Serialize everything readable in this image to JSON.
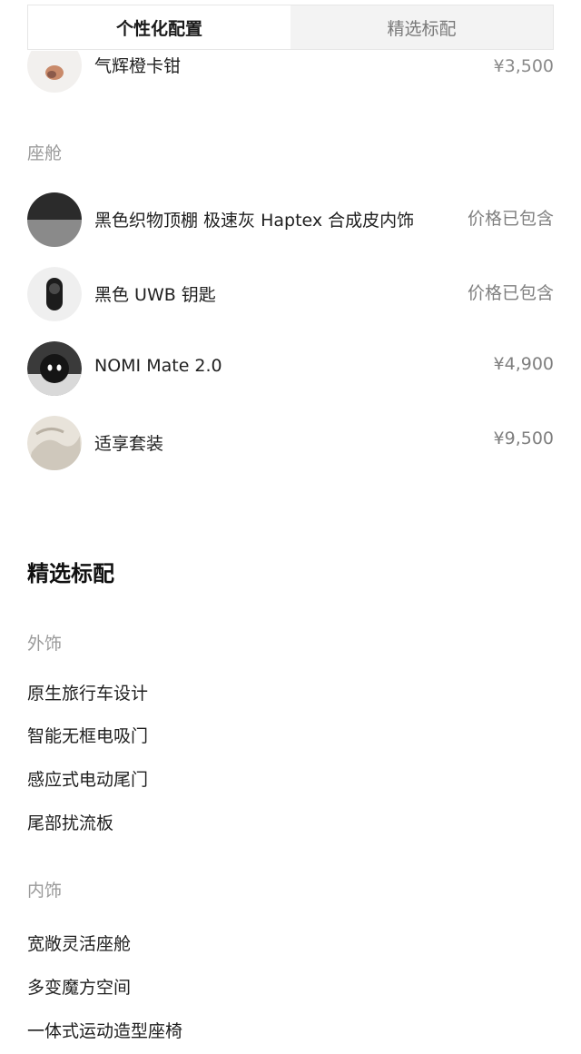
{
  "tabs": [
    {
      "label": "个性化配置",
      "active": true
    },
    {
      "label": "精选标配",
      "active": false
    }
  ],
  "partial_item": {
    "name": "气辉橙卡钳",
    "price": "¥3,500"
  },
  "cabin": {
    "label": "座舱",
    "items": [
      {
        "name": "黑色织物顶棚 极速灰 Haptex 合成皮内饰",
        "price": "价格已包含",
        "icon": "interior-swatch-icon"
      },
      {
        "name": "黑色 UWB 钥匙",
        "price": "价格已包含",
        "icon": "uwb-key-icon"
      },
      {
        "name": "NOMI Mate 2.0",
        "price": "¥4,900",
        "icon": "nomi-mate-icon"
      },
      {
        "name": "适享套装",
        "price": "¥9,500",
        "icon": "comfort-package-icon"
      }
    ]
  },
  "standard": {
    "title": "精选标配",
    "exterior": {
      "label": "外饰",
      "items": [
        "原生旅行车设计",
        "智能无框电吸门",
        "感应式电动尾门",
        "尾部扰流板"
      ]
    },
    "interior": {
      "label": "内饰",
      "items": [
        "宽敞灵活座舱",
        "多变魔方空间",
        "一体式运动造型座椅"
      ]
    }
  }
}
